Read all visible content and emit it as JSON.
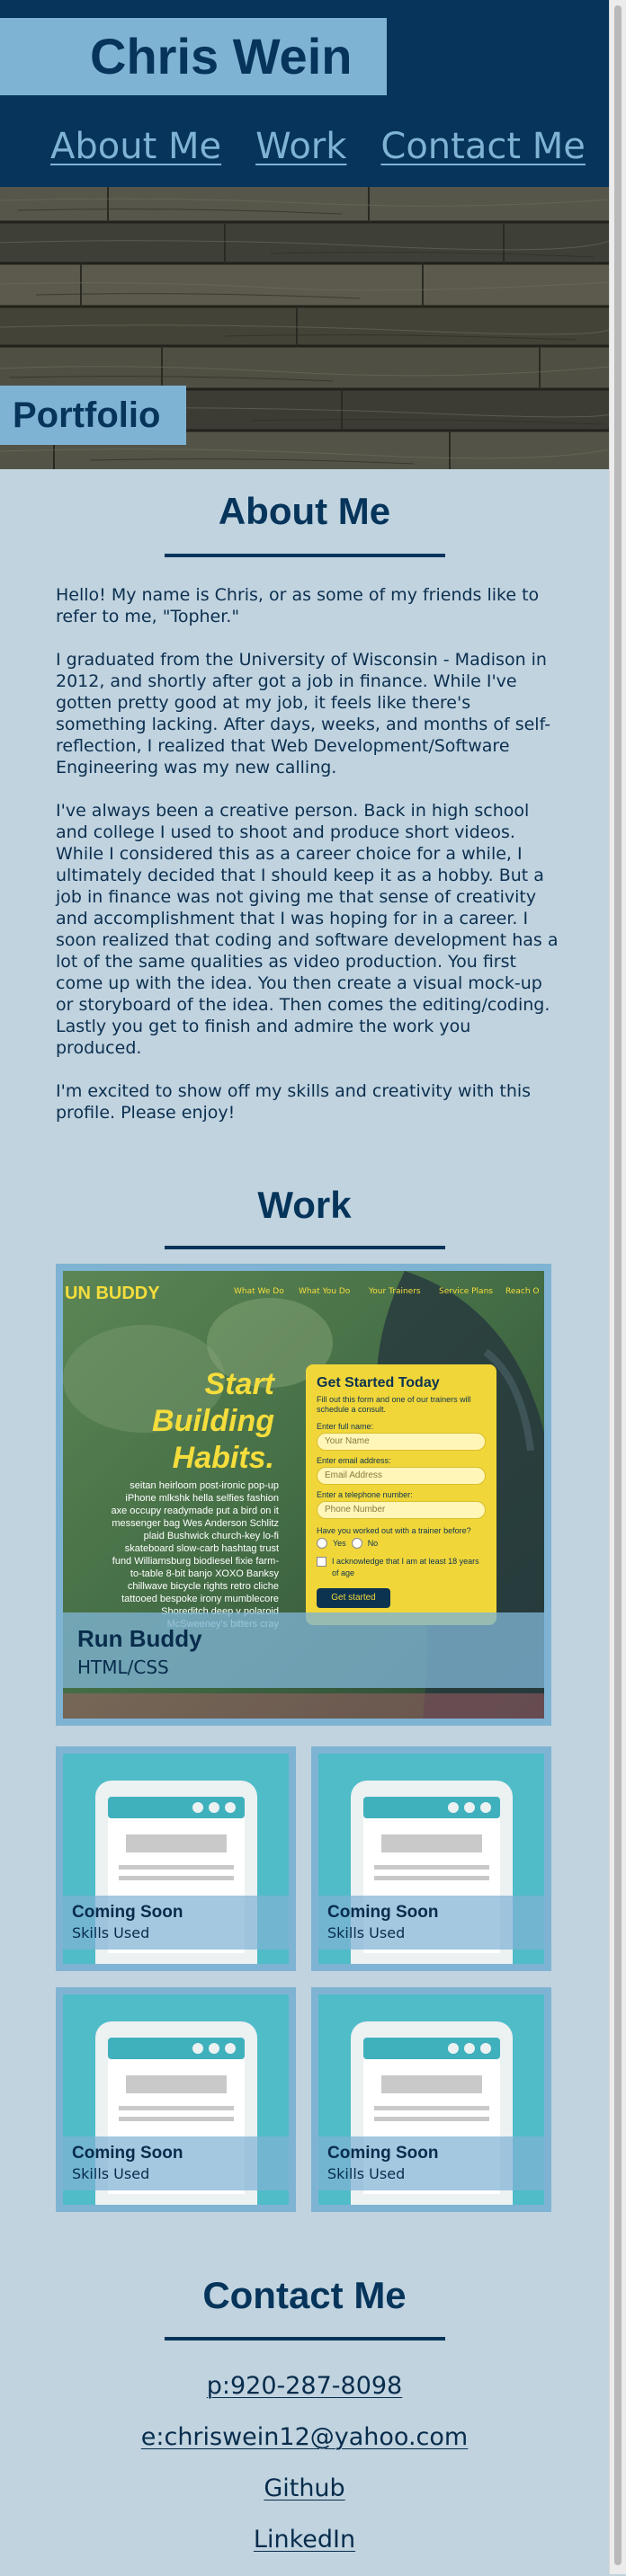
{
  "header": {
    "name": "Chris Wein",
    "nav": [
      "About Me",
      "Work",
      "Contact Me"
    ]
  },
  "hero": {
    "label": "Portfolio"
  },
  "about": {
    "heading": "About Me",
    "paragraphs": [
      "Hello! My name is Chris, or as some of my friends like to refer to me, \"Topher.\"",
      "I graduated from the University of Wisconsin - Madison in 2012, and shortly after got a job in finance. While I've gotten pretty good at my job, it feels like there's something lacking. After days, weeks, and months of self-reflection, I realized that Web Development/Software Engineering was my new calling.",
      "I've always been a creative person. Back in high school and college I used to shoot and produce short videos. While I considered this as a career choice for a while, I ultimately decided that I should keep it as a hobby. But a job in finance was not giving me that sense of creativity and accomplishment that I was hoping for in a career. I soon realized that coding and software development has a lot of the same qualities as video production. You first come up with the idea. You then create a visual mock-up or storyboard of the idea. Then comes the editing/coding. Lastly you get to finish and admire the work you produced.",
      "I'm excited to show off my skills and creativity with this profile. Please enjoy!"
    ]
  },
  "work": {
    "heading": "Work",
    "featured": {
      "title": "Run Buddy",
      "skills": "HTML/CSS",
      "screenshot": {
        "logo": "UN BUDDY",
        "nav": [
          "What We Do",
          "What You Do",
          "Your Trainers",
          "Service Plans",
          "Reach O"
        ],
        "headline": [
          "Start",
          "Building",
          "Habits."
        ],
        "blurb": "seitan heirloom post-ironic pop-up iPhone mlkshk hella selfies fashion axe occupy readymade put a bird on it messenger bag Wes Anderson Schlitz plaid Bushwick church-key lo-fi skateboard slow-carb hashtag trust fund Williamsburg biodiesel fixie farm-to-table 8-bit banjo XOXO Banksy chillwave bicycle rights retro cliche tattooed bespoke irony mumblecore Shoreditch deep v polaroid McSweeney's bitters cray",
        "form_title": "Get Started Today",
        "form_intro": "Fill out this form and one of our trainers will schedule a consult.",
        "label_name": "Enter full name:",
        "ph_name": "Your Name",
        "label_email": "Enter email address:",
        "ph_email": "Email Address",
        "label_phone": "Enter a telephone number:",
        "ph_phone": "Phone Number",
        "question": "Have you worked out with a trainer before?",
        "yes": "Yes",
        "no": "No",
        "ack": "I acknowledge that I am at least 18 years of age",
        "submit": "Get started"
      }
    },
    "cards": [
      {
        "title": "Coming Soon",
        "skills": "Skills Used"
      },
      {
        "title": "Coming Soon",
        "skills": "Skills Used"
      },
      {
        "title": "Coming Soon",
        "skills": "Skills Used"
      },
      {
        "title": "Coming Soon",
        "skills": "Skills Used"
      }
    ]
  },
  "contact": {
    "heading": "Contact Me",
    "links": [
      "p:920-287-8098",
      "e:chriswein12@yahoo.com",
      "Github",
      "LinkedIn"
    ]
  },
  "colors": {
    "navy": "#06345a",
    "light_blue": "#7fb3d4",
    "background": "#c0d3df",
    "teal": "#4fbcc8",
    "runbuddy_yellow": "#f5dd3c"
  }
}
